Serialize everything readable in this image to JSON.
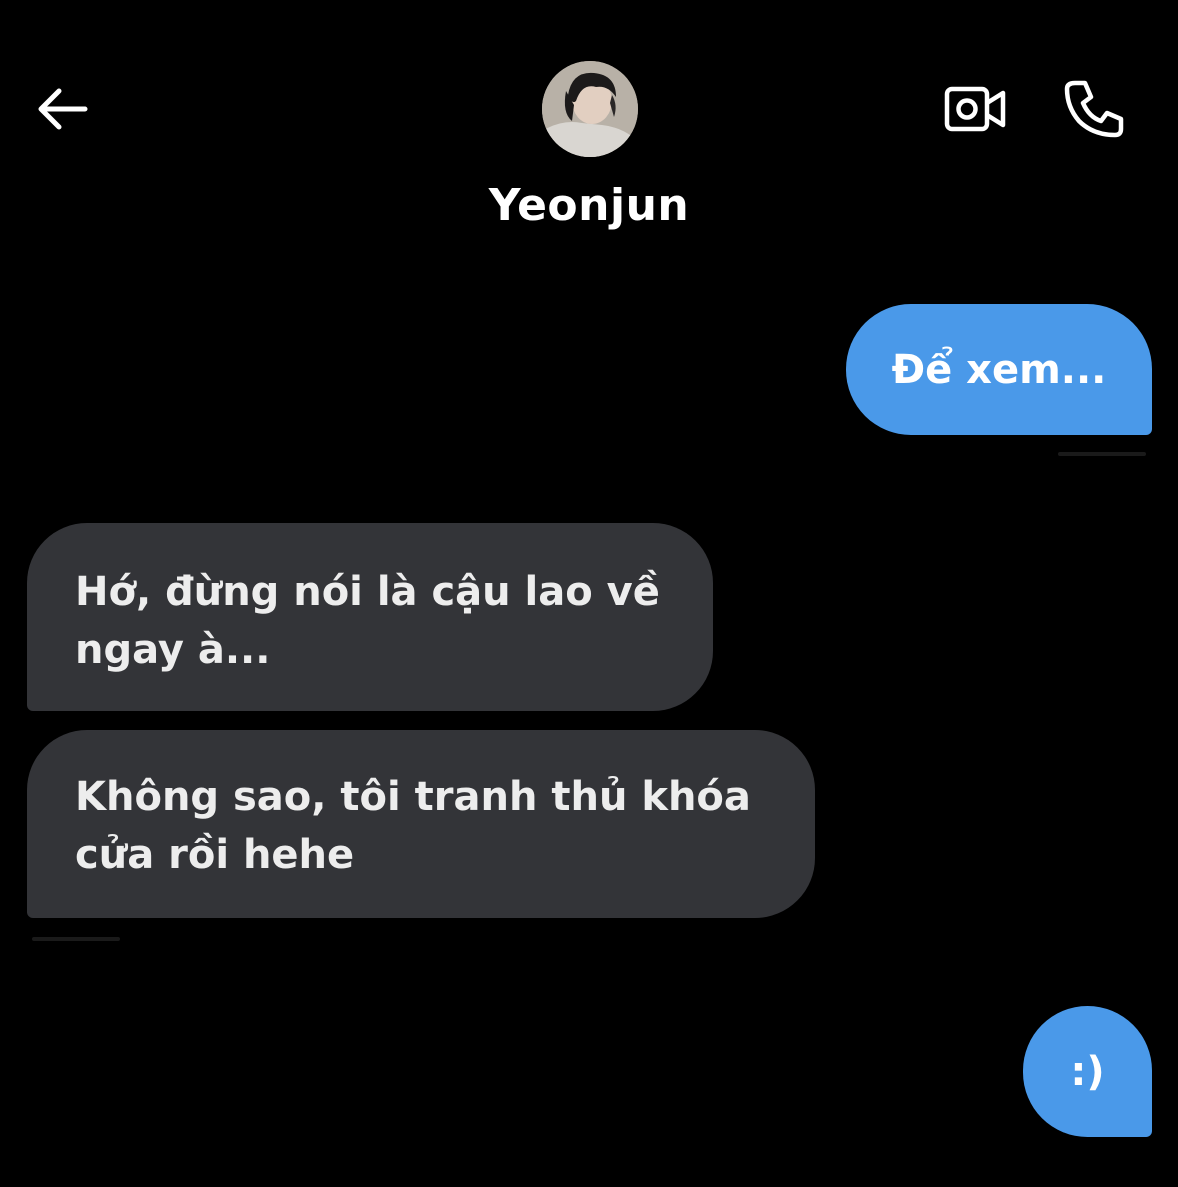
{
  "header": {
    "contact_name": "Yeonjun",
    "icons": {
      "back": "arrow-left-icon",
      "video": "video-camera-icon",
      "phone": "phone-icon"
    }
  },
  "messages": [
    {
      "direction": "outgoing",
      "text": "Để xem..."
    },
    {
      "direction": "incoming",
      "text": "Hớ, đừng nói là cậu lao về ngay à..."
    },
    {
      "direction": "incoming",
      "text": "Không sao, tôi tranh thủ khóa cửa rồi hehe"
    },
    {
      "direction": "outgoing",
      "text": ":)"
    }
  ],
  "colors": {
    "background": "#000000",
    "outgoing_bubble": "#4a99e9",
    "incoming_bubble": "#333438",
    "text": "#ffffff"
  }
}
